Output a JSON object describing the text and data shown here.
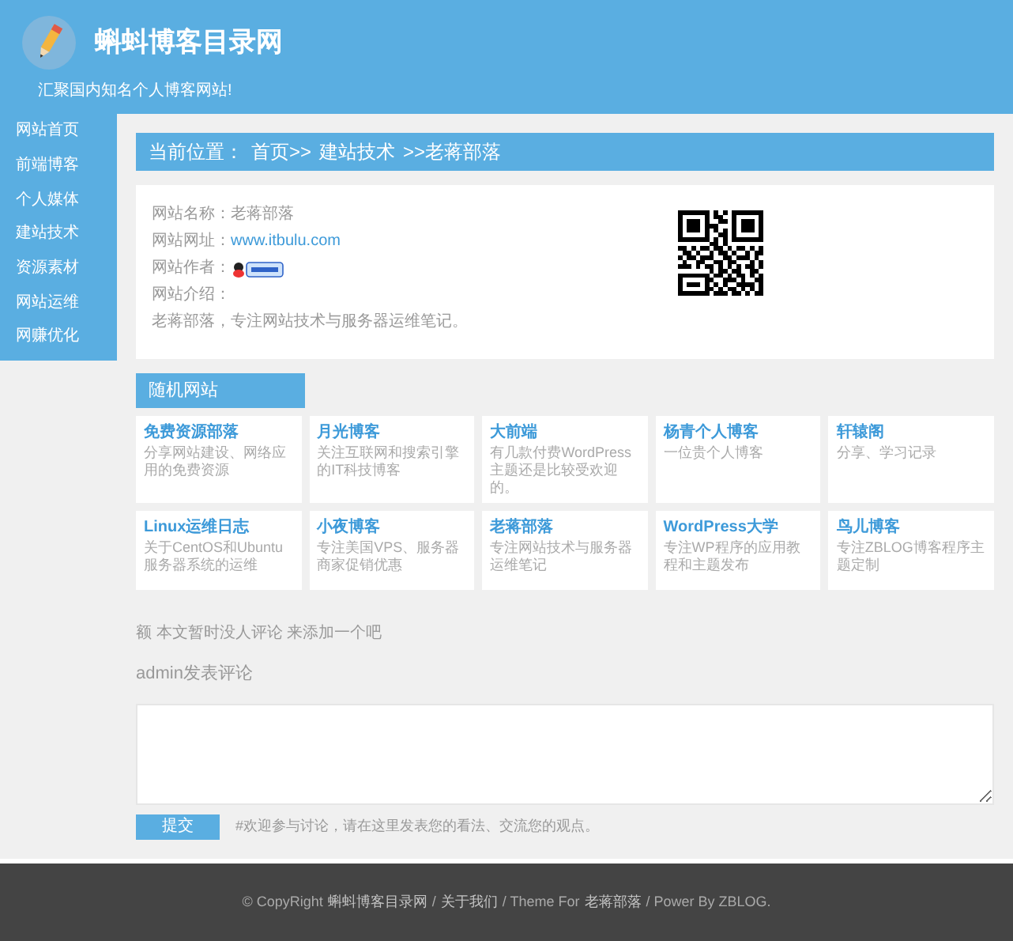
{
  "header": {
    "title": "蝌蚪博客目录网",
    "tagline": "汇聚国内知名个人博客网站!"
  },
  "sidebar": {
    "items": [
      {
        "label": "网站首页"
      },
      {
        "label": "前端博客"
      },
      {
        "label": "个人媒体"
      },
      {
        "label": "建站技术"
      },
      {
        "label": "资源素材"
      },
      {
        "label": "网站运维"
      },
      {
        "label": "网赚优化"
      }
    ]
  },
  "breadcrumb": {
    "label": "当前位置：",
    "items": [
      "首页>>",
      "建站技术",
      ">>老蒋部落"
    ]
  },
  "info": {
    "rows": [
      {
        "kind": "text",
        "label": "网站名称：",
        "value": "老蒋部落"
      },
      {
        "kind": "link",
        "label": "网站网址：",
        "value": "www.itbulu.com"
      },
      {
        "kind": "badge",
        "label": "网站作者："
      },
      {
        "kind": "text",
        "label": "网站介绍："
      },
      {
        "kind": "para",
        "value": "老蒋部落，专注网站技术与服务器运维笔记。"
      }
    ]
  },
  "random": {
    "title": "随机网站",
    "cards": [
      {
        "title": "免费资源部落",
        "desc": "分享网站建设、网络应用的免费资源"
      },
      {
        "title": "月光博客",
        "desc": "关注互联网和搜索引擎的IT科技博客"
      },
      {
        "title": "大前端",
        "desc": "有几款付费WordPress主题还是比较受欢迎的。"
      },
      {
        "title": "杨青个人博客",
        "desc": "一位贵个人博客"
      },
      {
        "title": "轩辕阁",
        "desc": "分享、学习记录"
      },
      {
        "title": "Linux运维日志",
        "desc": "关于CentOS和Ubuntu服务器系统的运维"
      },
      {
        "title": "小夜博客",
        "desc": "专注美国VPS、服务器商家促销优惠"
      },
      {
        "title": "老蒋部落",
        "desc": "专注网站技术与服务器运维笔记"
      },
      {
        "title": "WordPress大学",
        "desc": "专注WP程序的应用教程和主题发布"
      },
      {
        "title": "鸟儿博客",
        "desc": "专注ZBLOG博客程序主题定制"
      }
    ]
  },
  "comments": {
    "empty": "额 本文暂时没人评论 来添加一个吧",
    "heading": "admin发表评论",
    "submit": "提交",
    "hint": "#欢迎参与讨论，请在这里发表您的看法、交流您的观点。"
  },
  "footer": {
    "parts": [
      {
        "kind": "text",
        "text": "© CopyRight"
      },
      {
        "kind": "link",
        "text": "蝌蚪博客目录网"
      },
      {
        "kind": "text",
        "text": "/"
      },
      {
        "kind": "link",
        "text": "关于我们"
      },
      {
        "kind": "text",
        "text": "/ Theme For"
      },
      {
        "kind": "link",
        "text": "老蒋部落"
      },
      {
        "kind": "text",
        "text": "/ Power By ZBLOG."
      }
    ]
  }
}
